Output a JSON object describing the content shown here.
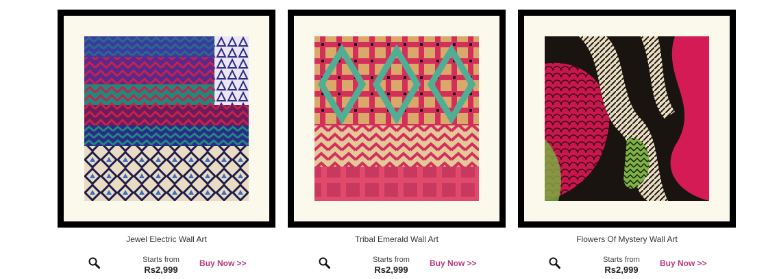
{
  "products": [
    {
      "title": "Jewel Electric Wall Art",
      "price_prefix": "Starts from",
      "price": "Rs2,999",
      "buy_label": "Buy Now >>",
      "zoom_icon": "magnifier-icon",
      "palette": [
        "#2a1f6e",
        "#c8214e",
        "#1e8a7a",
        "#e8dcc4",
        "#3a4fb0"
      ]
    },
    {
      "title": "Tribal Emerald Wall Art",
      "price_prefix": "Starts from",
      "price": "Rs2,999",
      "buy_label": "Buy Now >>",
      "zoom_icon": "magnifier-icon",
      "palette": [
        "#d9a86a",
        "#d42f5a",
        "#4fae93",
        "#1a1a1a",
        "#e3c89a"
      ]
    },
    {
      "title": "Flowers Of Mystery Wall Art",
      "price_prefix": "Starts from",
      "price": "Rs2,999",
      "buy_label": "Buy Now >>",
      "zoom_icon": "magnifier-icon",
      "palette": [
        "#1a1410",
        "#c9174d",
        "#7cb342",
        "#eadfc4",
        "#d41b55"
      ]
    }
  ],
  "colors": {
    "frame": "#000000",
    "mat": "#fbf8ec",
    "buy_link": "#b83a83"
  }
}
